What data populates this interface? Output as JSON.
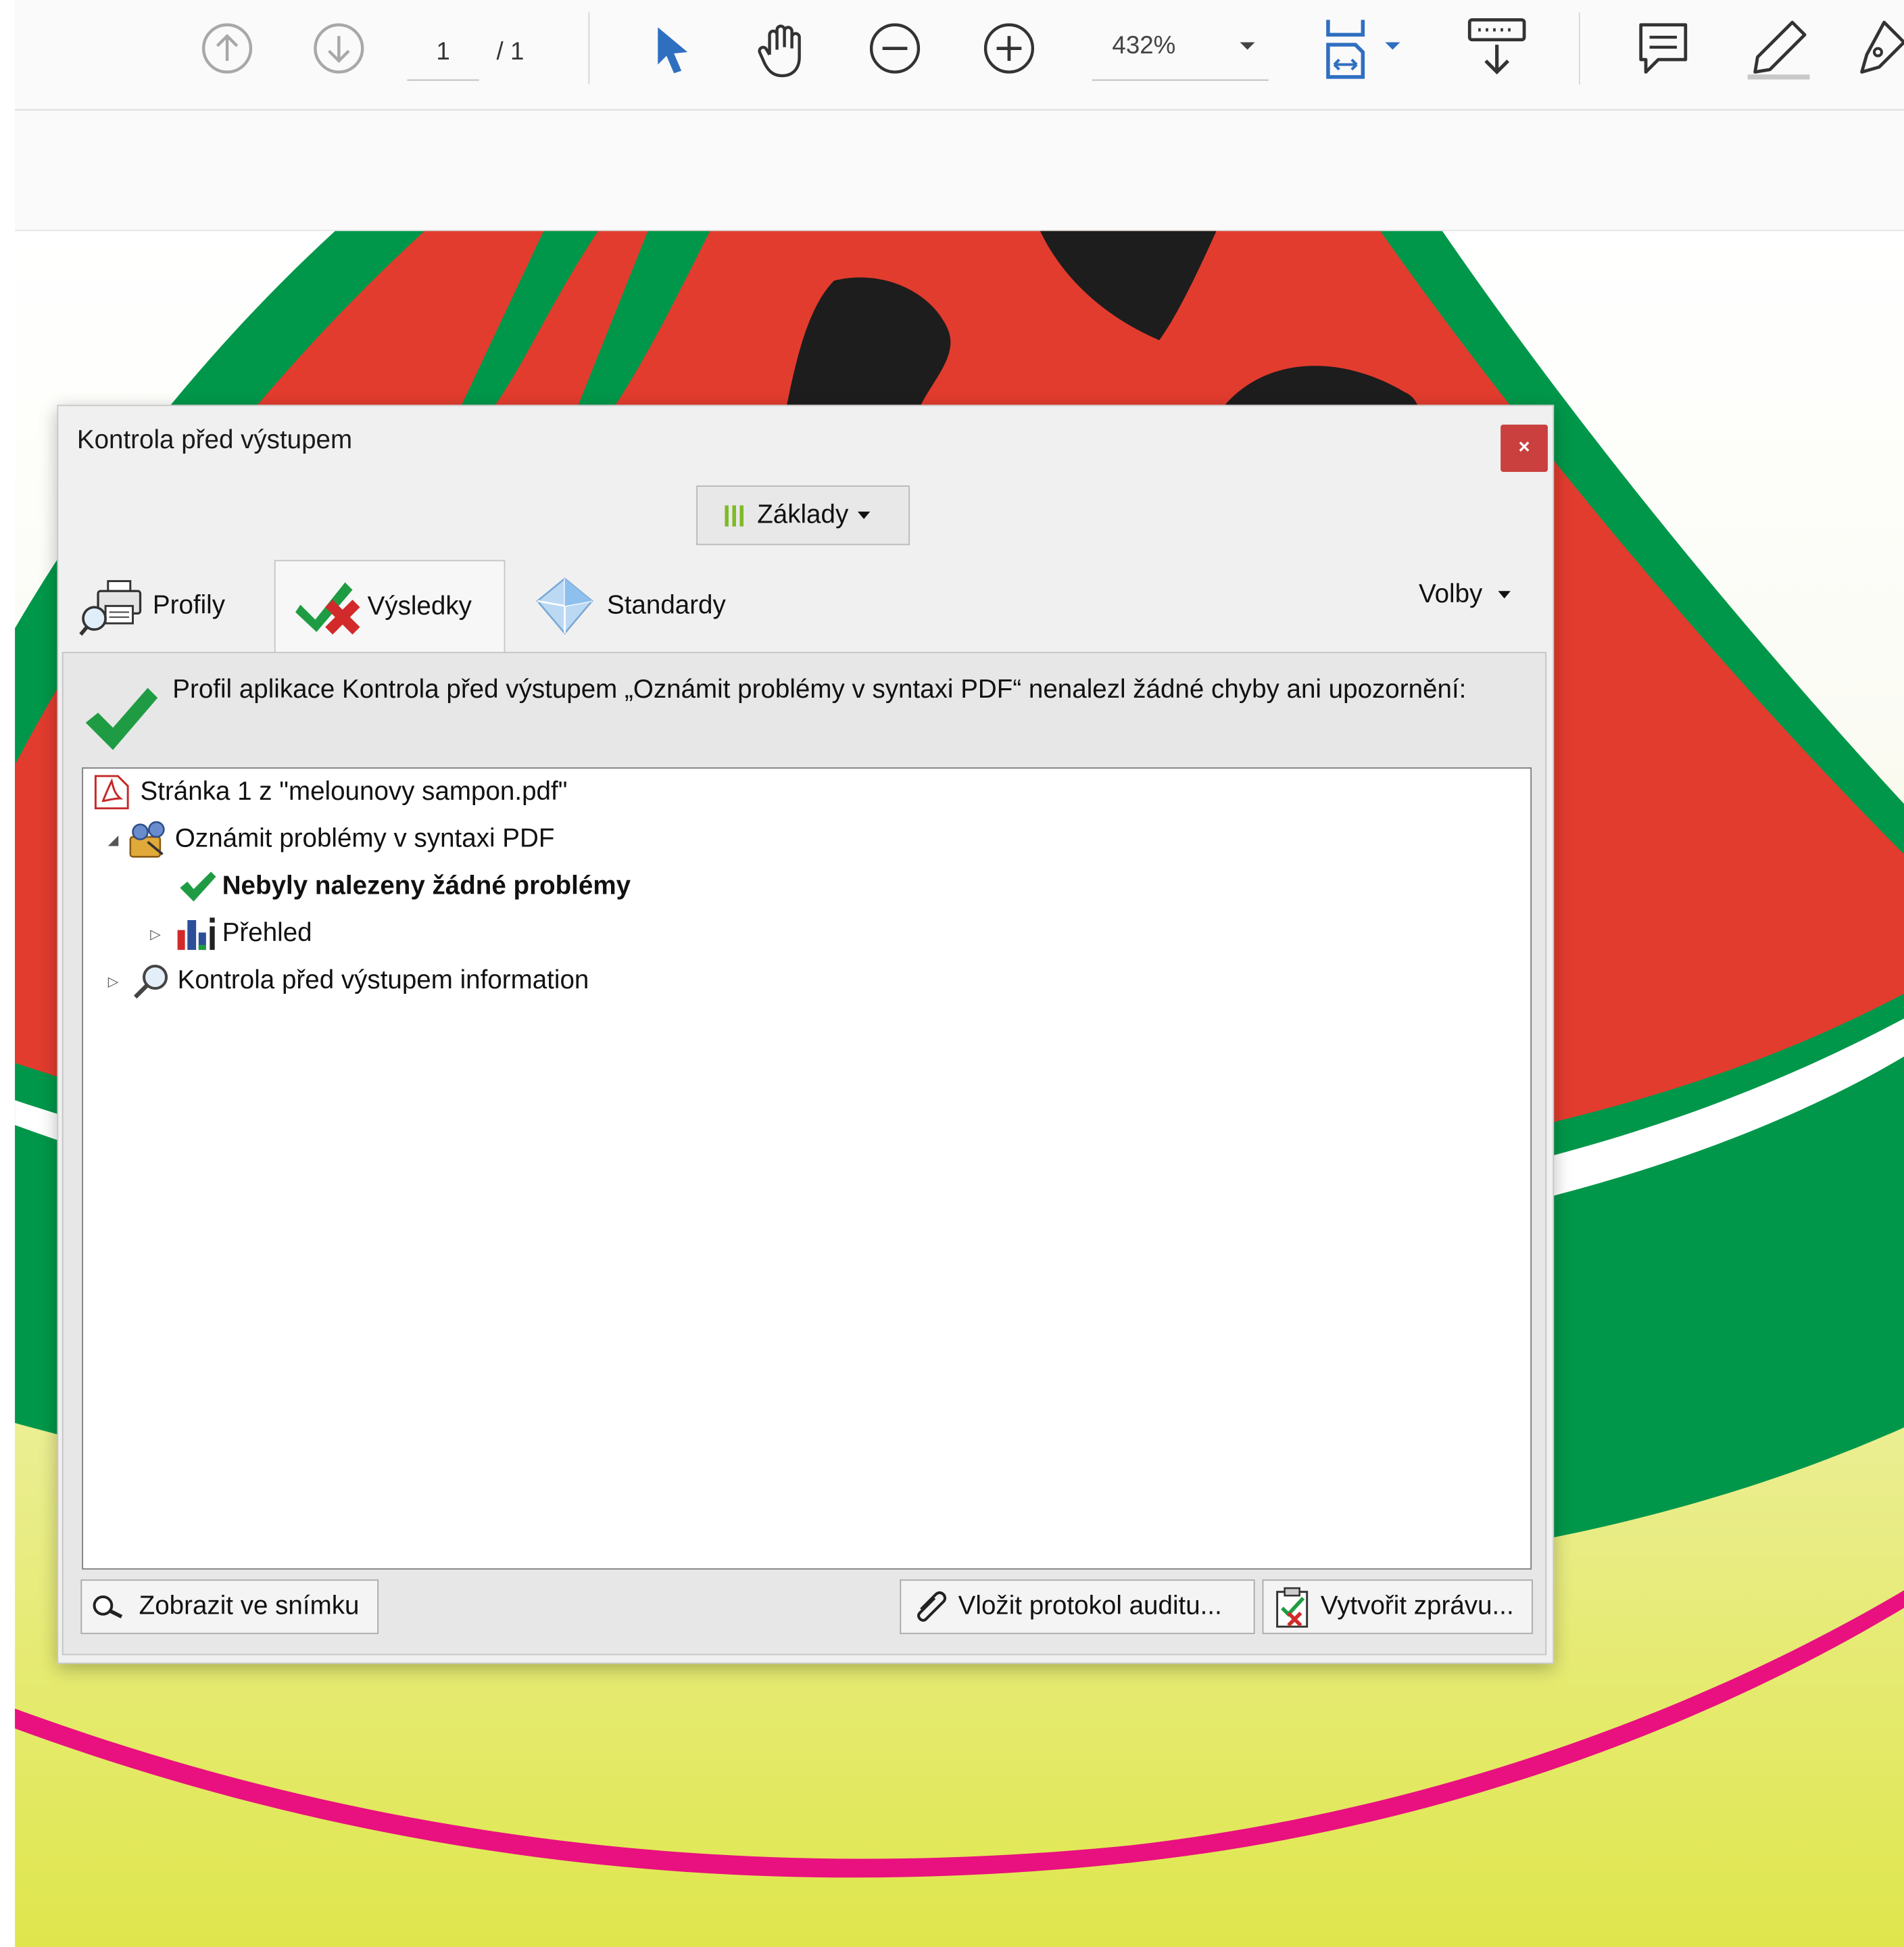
{
  "toolbar": {
    "page_current": "1",
    "page_total": "/ 1",
    "zoom": "432%"
  },
  "colors": {
    "accent_blue": "#2f6fc0",
    "watermelon_red": "#e23c2e",
    "rind_green": "#00974a",
    "seed": "#1d1d1d",
    "pink_line": "#e8117f",
    "close_button": "#c9403f"
  },
  "dialog": {
    "title": "Kontrola před výstupem",
    "close_label": "×",
    "view_selector": "Základy",
    "tabs": [
      {
        "label": "Profily",
        "icon": "printer-magnifier-icon",
        "active": false
      },
      {
        "label": "Výsledky",
        "icon": "check-cross-icon",
        "active": true
      },
      {
        "label": "Standardy",
        "icon": "diamond-icon",
        "active": false
      }
    ],
    "options_label": "Volby",
    "summary": "Profil aplikace Kontrola před výstupem „Oznámit problémy v syntaxi PDF“ nenalezl žádné chyby ani upozornění:",
    "tree": [
      {
        "label": "Stránka 1 z \"melounovy sampon.pdf\"",
        "icon": "pdf-file-icon",
        "level": 0
      },
      {
        "label": "Oznámit problémy v syntaxi PDF",
        "icon": "preflight-profile-icon",
        "level": 1,
        "expanded": true
      },
      {
        "label": "Nebyly nalezeny žádné problémy",
        "icon": "green-check-icon",
        "level": 2,
        "bold": true
      },
      {
        "label": "Přehled",
        "icon": "overview-chart-icon",
        "level": 2,
        "expanded": false
      },
      {
        "label": "Kontrola před výstupem information",
        "icon": "magnifier-info-icon",
        "level": 1,
        "expanded": false
      }
    ],
    "buttons": {
      "show_snap": "Zobrazit ve snímku",
      "embed_audit": "Vložit protokol auditu...",
      "create_report": "Vytvořit zprávu..."
    }
  }
}
